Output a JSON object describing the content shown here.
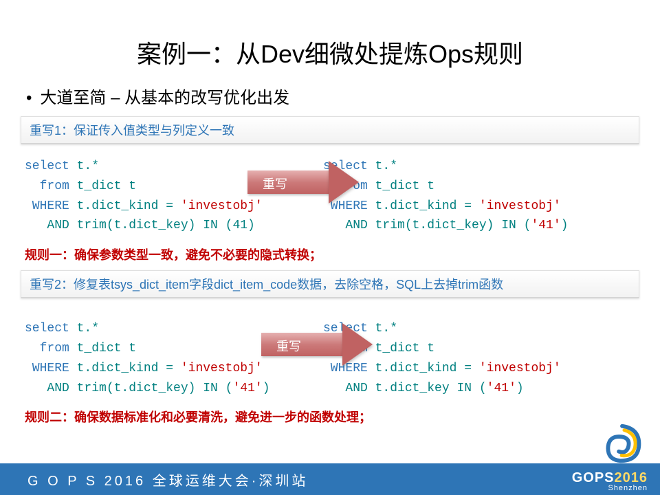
{
  "title": "案例一：从Dev细微处提炼Ops规则",
  "bullet": "•",
  "subtitle": "大道至简 – 从基本的改写优化出发",
  "section1": {
    "header": "重写1：保证传入值类型与列定义一致",
    "arrow_label": "重写",
    "code_left": {
      "l1a": "select",
      "l1b": " t.*",
      "l2a": "  from",
      "l2b": " t_dict t",
      "l3a": " WHERE",
      "l3b": " t.dict_kind = ",
      "l3c": "'investobj'",
      "l4a": "   AND trim(t.dict_key) IN (41)"
    },
    "code_right": {
      "l1a": "select",
      "l1b": " t.*",
      "l2a": "  from",
      "l2b": " t_dict t",
      "l3a": " WHERE",
      "l3b": " t.dict_kind = ",
      "l3c": "'investobj'",
      "l4a": "   AND trim(t.dict_key) IN (",
      "l4b": "'41'",
      "l4c": ")"
    },
    "rule": "规则一：确保参数类型一致，避免不必要的隐式转换；"
  },
  "section2": {
    "header": "重写2：修复表tsys_dict_item字段dict_item_code数据，去除空格，SQL上去掉trim函数",
    "arrow_label": "重写",
    "code_left": {
      "l1a": "select",
      "l1b": " t.*",
      "l2a": "  from",
      "l2b": " t_dict t",
      "l3a": " WHERE",
      "l3b": " t.dict_kind = ",
      "l3c": "'investobj'",
      "l4a": "   AND ",
      "l4b": "trim(t.dict_key)",
      "l4c": " IN (",
      "l4d": "'41'",
      "l4e": ")"
    },
    "code_right": {
      "l1a": "select",
      "l1b": " t.*",
      "l2a": "  from",
      "l2b": " t_dict t",
      "l3a": " WHERE",
      "l3b": " t.dict_kind = ",
      "l3c": "'investobj'",
      "l4a": "   AND ",
      "l4b": "t.dict_key",
      "l4c": " IN (",
      "l4d": "'41'",
      "l4e": ")"
    },
    "rule": "规则二：确保数据标准化和必要清洗，避免进一步的函数处理；"
  },
  "footer": {
    "text": "G O P S 2016 全球运维大会·深圳站",
    "logo_gops": "GOPS",
    "logo_year": "2016",
    "logo_sub": "Shenzhen"
  }
}
